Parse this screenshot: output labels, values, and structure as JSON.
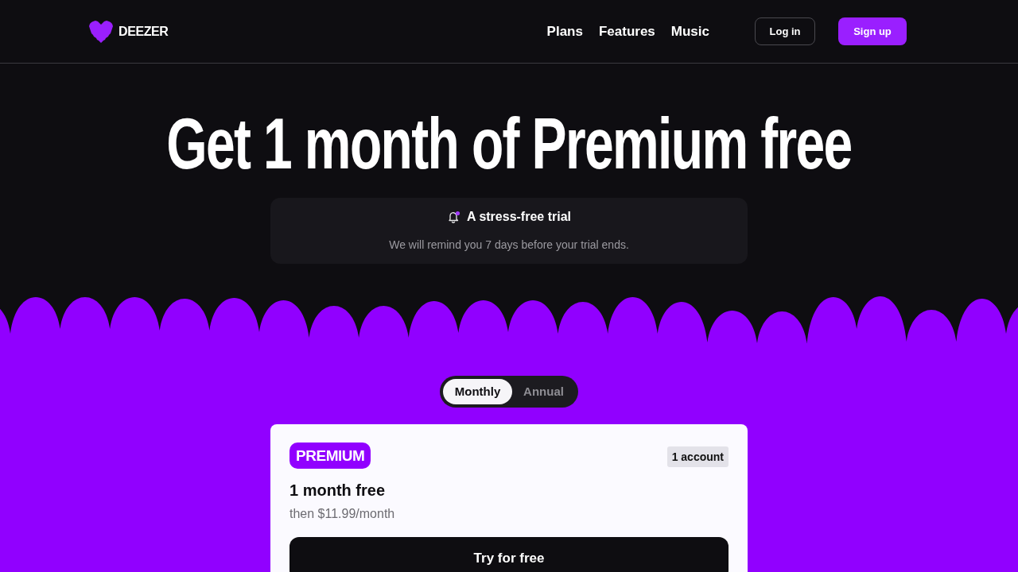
{
  "header": {
    "logo": "DEEZER",
    "nav": [
      "Plans",
      "Features",
      "Music"
    ],
    "buttons": [
      {
        "label": "Log in",
        "kind": "outline"
      },
      {
        "label": "Sign up",
        "kind": "primary"
      }
    ]
  },
  "hero": {
    "title": "Get 1 month of Premium free",
    "notice": {
      "title": "A stress-free trial",
      "text": "We will remind you 7 days before your trial ends."
    }
  },
  "billing_toggle": [
    {
      "label": "Monthly",
      "selected": true
    },
    {
      "label": "Annual",
      "selected": false
    }
  ],
  "plan_card": {
    "badge": "PREMIUM",
    "tag": "1 account",
    "title": "1 month free",
    "price": "then $11.99/month",
    "button": "Try for free"
  }
}
